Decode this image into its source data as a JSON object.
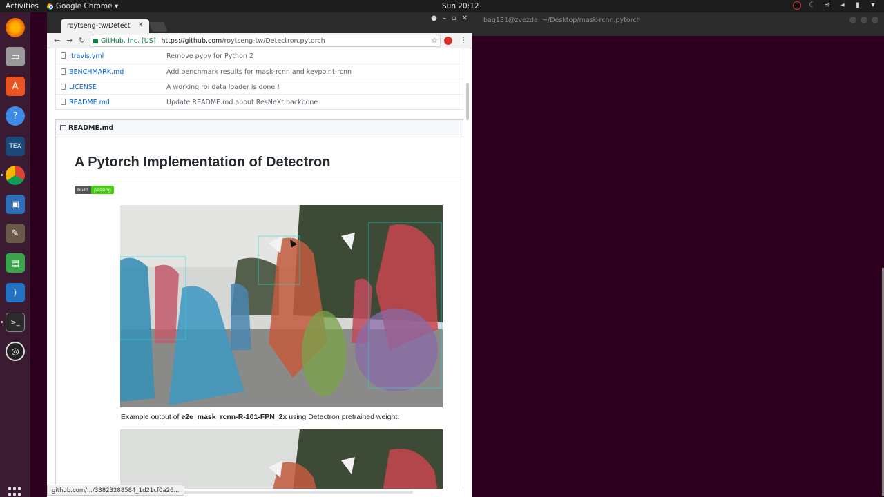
{
  "topbar": {
    "activities": "Activities",
    "app_name": "Google Chrome ▾",
    "clock": "Sun 20:12"
  },
  "terminal": {
    "title": "bag131@zvezda: ~/Desktop/mask-rcnn.pytorch"
  },
  "browser": {
    "tab_title": "roytseng-tw/Detect",
    "secure_label": "GitHub, Inc. [US]",
    "url_host": "https://github.com",
    "url_path": "/roytseng-tw/Detectron.pytorch",
    "status_url": "github.com/.../33823288584_1d21cf0a26..."
  },
  "files": [
    {
      "name": ".travis.yml",
      "message": "Remove pypy for Python 2"
    },
    {
      "name": "BENCHMARK.md",
      "message": "Add benchmark results for mask-rcnn and keypoint-rcnn"
    },
    {
      "name": "LICENSE",
      "message": "A working roi data loader is done !"
    },
    {
      "name": "README.md",
      "message": "Update README.md about ResNeXt backbone"
    }
  ],
  "readme": {
    "header": "README.md",
    "title": "A Pytorch Implementation of Detectron",
    "badge_left": "build",
    "badge_right": "passing",
    "caption_prefix": "Example output of ",
    "caption_model": "e2e_mask_rcnn-R-101-FPN_2x",
    "caption_suffix": " using Detectron pretrained weight."
  },
  "colors": {
    "link": "#0366d6",
    "badge_pass": "#44cc11",
    "desktop_bg": "#2c001e"
  }
}
